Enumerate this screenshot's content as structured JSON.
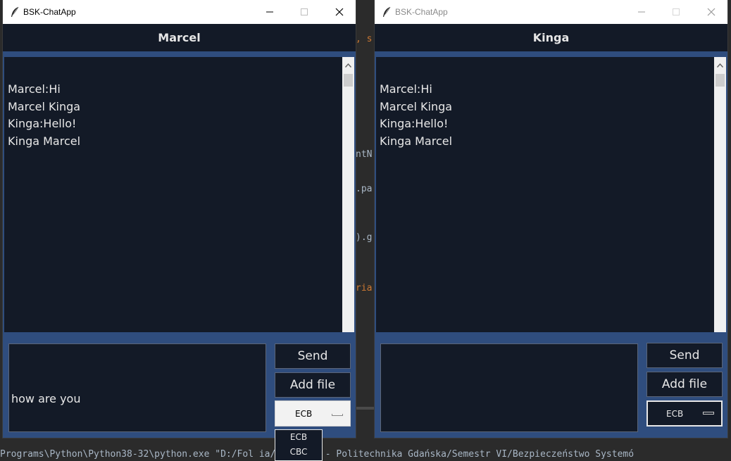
{
  "background_code": {
    "line1": ", s",
    "line2": "ntN",
    "line3": ".pa",
    "line4": ").g",
    "line5": "ria",
    "console": "Programs\\Python\\Python38-32\\python.exe \"D:/Fol   ia/OneDrive - Politechnika Gdańska/Semestr VI/Bezpieczeństwo Systemó"
  },
  "window_left": {
    "title": "BSK-ChatApp",
    "header": "Marcel",
    "messages": [
      "Marcel:Hi",
      "Marcel Kinga",
      "Kinga:Hello!",
      "Kinga Marcel"
    ],
    "input_value": "how are you",
    "send_label": "Send",
    "add_file_label": "Add file",
    "mode_selected": "ECB",
    "dropdown_options": [
      "ECB",
      "CBC"
    ]
  },
  "window_right": {
    "title": "BSK-ChatApp",
    "header": "Kinga",
    "messages": [
      "Marcel:Hi",
      "Marcel Kinga",
      "Kinga:Hello!",
      "Kinga Marcel"
    ],
    "input_value": "",
    "send_label": "Send",
    "add_file_label": "Add file",
    "mode_selected": "ECB"
  },
  "icons": {
    "app": "feather-icon",
    "minimize": "minimize-icon",
    "maximize": "maximize-icon",
    "close": "close-icon",
    "scroll_up": "chevron-up-icon"
  },
  "colors": {
    "panel_bg": "#131a27",
    "accent_border": "#2f4d7e",
    "text": "#e8e8e8"
  }
}
